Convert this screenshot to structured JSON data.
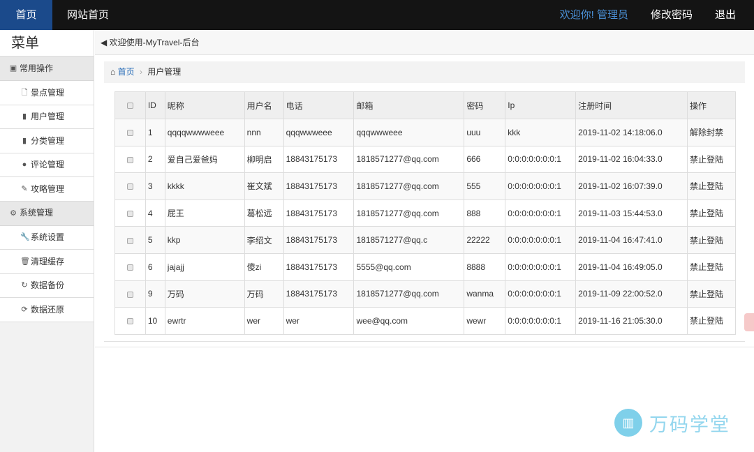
{
  "topbar": {
    "home_label": "首页",
    "site_label": "网站首页",
    "welcome_prefix": "欢迎你!",
    "welcome_user": "管理员",
    "change_password": "修改密码",
    "logout": "退出"
  },
  "sidebar": {
    "title": "菜单",
    "group1": "常用操作",
    "items1": [
      "景点管理",
      "用户管理",
      "分类管理",
      "评论管理",
      "攻略管理"
    ],
    "group2": "系统管理",
    "items2": [
      "系统设置",
      "清理缓存",
      "数据备份",
      "数据还原"
    ]
  },
  "main": {
    "welcome": "欢迎使用-MyTravel-后台",
    "breadcrumb_home": "首页",
    "breadcrumb_current": "用户管理"
  },
  "table": {
    "headers": [
      "ID",
      "昵称",
      "用户名",
      "电话",
      "邮箱",
      "密码",
      "Ip",
      "注册时间",
      "操作"
    ],
    "rows": [
      {
        "id": "1",
        "nick": "qqqqwwwweee",
        "user": "nnn",
        "phone": "qqqwwweee",
        "email": "qqqwwweee",
        "pwd": "uuu",
        "ip": "kkk",
        "time": "2019-11-02 14:18:06.0",
        "op": "解除封禁"
      },
      {
        "id": "2",
        "nick": "爱自己爱爸妈",
        "user": "柳明启",
        "phone": "18843175173",
        "email": "1818571277@qq.com",
        "pwd": "666",
        "ip": "0:0:0:0:0:0:0:1",
        "time": "2019-11-02 16:04:33.0",
        "op": "禁止登陆"
      },
      {
        "id": "3",
        "nick": "kkkk",
        "user": "崔文斌",
        "phone": "18843175173",
        "email": "1818571277@qq.com",
        "pwd": "555",
        "ip": "0:0:0:0:0:0:0:1",
        "time": "2019-11-02 16:07:39.0",
        "op": "禁止登陆"
      },
      {
        "id": "4",
        "nick": "屁王",
        "user": "葛松远",
        "phone": "18843175173",
        "email": "1818571277@qq.com",
        "pwd": "888",
        "ip": "0:0:0:0:0:0:0:1",
        "time": "2019-11-03 15:44:53.0",
        "op": "禁止登陆"
      },
      {
        "id": "5",
        "nick": "kkp",
        "user": "李绍文",
        "phone": "18843175173",
        "email": "1818571277@qq.c",
        "pwd": "22222",
        "ip": "0:0:0:0:0:0:0:1",
        "time": "2019-11-04 16:47:41.0",
        "op": "禁止登陆"
      },
      {
        "id": "6",
        "nick": "jajajj",
        "user": "傻zi",
        "phone": "18843175173",
        "email": "5555@qq.com",
        "pwd": "8888",
        "ip": "0:0:0:0:0:0:0:1",
        "time": "2019-11-04 16:49:05.0",
        "op": "禁止登陆"
      },
      {
        "id": "9",
        "nick": "万码",
        "user": "万码",
        "phone": "18843175173",
        "email": "1818571277@qq.com",
        "pwd": "wanma",
        "ip": "0:0:0:0:0:0:0:1",
        "time": "2019-11-09 22:00:52.0",
        "op": "禁止登陆"
      },
      {
        "id": "10",
        "nick": "ewrtr",
        "user": "wer",
        "phone": "wer",
        "email": "wee@qq.com",
        "pwd": "wewr",
        "ip": "0:0:0:0:0:0:0:1",
        "time": "2019-11-16 21:05:30.0",
        "op": "禁止登陆"
      }
    ]
  },
  "watermark": {
    "text": "万码学堂"
  },
  "colors": {
    "accent": "#1b4a8b",
    "link": "#3a7cc3",
    "topbar": "#141414"
  }
}
